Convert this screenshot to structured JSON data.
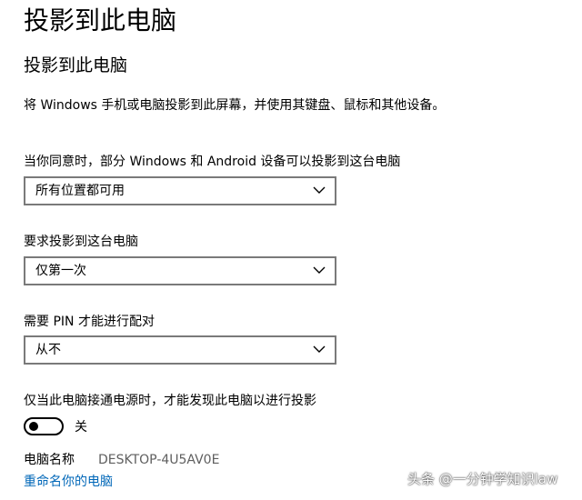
{
  "page": {
    "title": "投影到此电脑",
    "section_title": "投影到此电脑",
    "description": "将 Windows 手机或电脑投影到此屏幕，并使用其键盘、鼠标和其他设备。"
  },
  "settings": {
    "availability": {
      "label": "当你同意时，部分 Windows 和 Android 设备可以投影到这台电脑",
      "value": "所有位置都可用"
    },
    "ask_to_project": {
      "label": "要求投影到这台电脑",
      "value": "仅第一次"
    },
    "require_pin": {
      "label": "需要 PIN 才能进行配对",
      "value": "从不"
    },
    "power_discovery": {
      "label": "仅当此电脑接通电源时，才能发现此电脑以进行投影",
      "state_label": "关",
      "on": false
    }
  },
  "pc_name": {
    "label": "电脑名称",
    "value": "DESKTOP-4U5AV0E",
    "rename_link": "重命名你的电脑"
  },
  "watermark": {
    "text": "头条 @一分钟学知识law"
  },
  "colors": {
    "link": "#0067b8",
    "border": "#7a7a7a",
    "muted_text": "#5f5f5f"
  },
  "icons": {
    "dropdown": "chevron-down-icon"
  }
}
